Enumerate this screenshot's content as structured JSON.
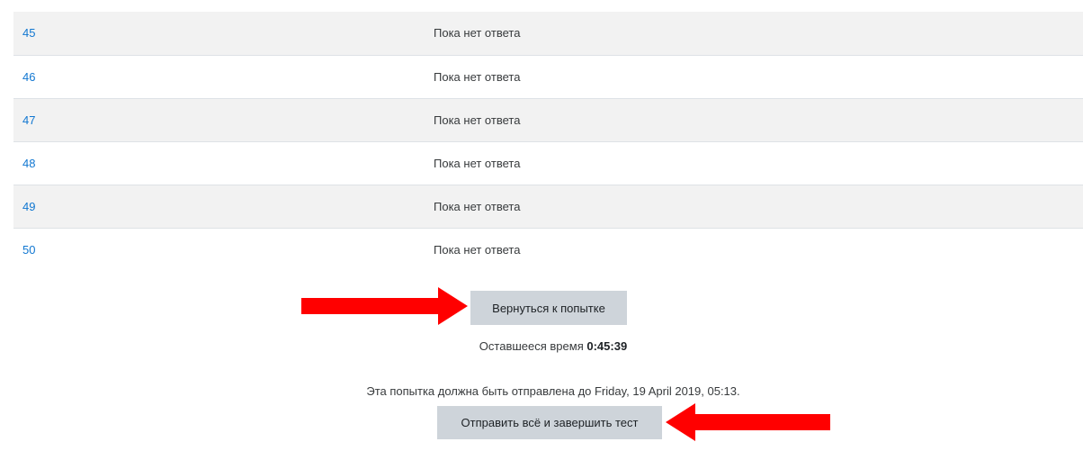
{
  "questions": [
    {
      "number": "45",
      "status": "Пока нет ответа"
    },
    {
      "number": "46",
      "status": "Пока нет ответа"
    },
    {
      "number": "47",
      "status": "Пока нет ответа"
    },
    {
      "number": "48",
      "status": "Пока нет ответа"
    },
    {
      "number": "49",
      "status": "Пока нет ответа"
    },
    {
      "number": "50",
      "status": "Пока нет ответа"
    }
  ],
  "return_button_label": "Вернуться к попытке",
  "time_left_label": "Оставшееся время",
  "time_left_value": "0:45:39",
  "due_text": "Эта попытка должна быть отправлена до Friday, 19 April 2019, 05:13.",
  "submit_button_label": "Отправить всё и завершить тест",
  "colors": {
    "link": "#1177d1",
    "button_bg": "#ced4da",
    "striped_row": "#f2f2f2",
    "arrow": "#ff0000"
  }
}
